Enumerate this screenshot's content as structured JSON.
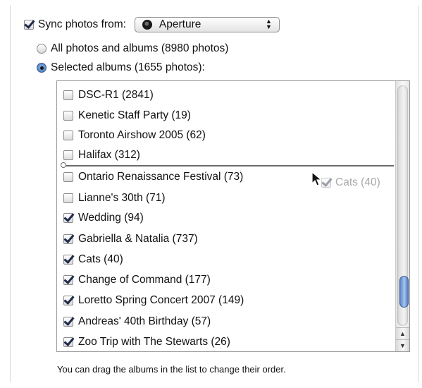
{
  "sync": {
    "checked": true,
    "label": "Sync photos from:",
    "source_value": "Aperture",
    "source_icon": "aperture-app-icon"
  },
  "options": {
    "all_label": "All photos and albums (8980 photos)",
    "selected_label": "Selected albums (1655 photos):",
    "selected_option": "selected"
  },
  "albums": [
    {
      "label": "DSC-R1 (2841)",
      "checked": false
    },
    {
      "label": "Kenetic Staff Party (19)",
      "checked": false
    },
    {
      "label": "Toronto Airshow 2005 (62)",
      "checked": false
    },
    {
      "label": "Halifax (312)",
      "checked": false
    },
    {
      "label": "Ontario Renaissance Festival (73)",
      "checked": false
    },
    {
      "label": "Lianne's 30th (71)",
      "checked": false
    },
    {
      "label": "Wedding (94)",
      "checked": true
    },
    {
      "label": "Gabriella & Natalia (737)",
      "checked": true
    },
    {
      "label": "Cats (40)",
      "checked": true
    },
    {
      "label": "Change of Command (177)",
      "checked": true
    },
    {
      "label": "Loretto Spring Concert 2007 (149)",
      "checked": true
    },
    {
      "label": "Andreas' 40th Birthday (57)",
      "checked": true
    },
    {
      "label": "Zoo Trip with The Stewarts (26)",
      "checked": true
    }
  ],
  "drag": {
    "label": "Cats (40)",
    "checked": true,
    "insert_after_index": 3
  },
  "footer": {
    "note": "You can drag the albums in the list to change their order."
  }
}
